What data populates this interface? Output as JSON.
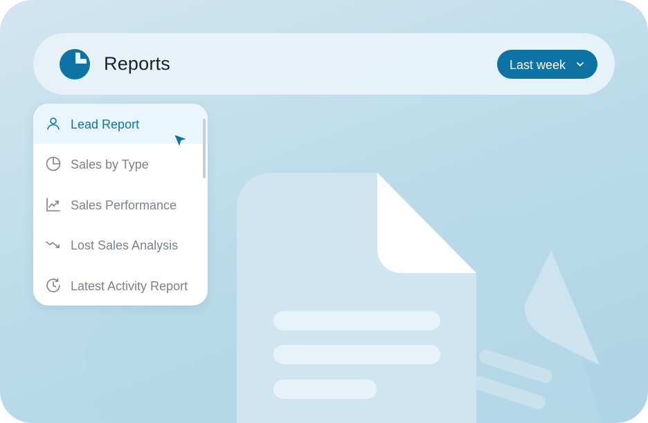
{
  "header": {
    "title": "Reports",
    "logo_icon": "pie-chart-icon",
    "period_button": {
      "label": "Last week",
      "icon": "chevron-down-icon"
    }
  },
  "menu": {
    "items": [
      {
        "label": "Lead Report",
        "icon": "user-icon",
        "active": true
      },
      {
        "label": "Sales by Type",
        "icon": "pie-chart-icon",
        "active": false
      },
      {
        "label": "Sales Performance",
        "icon": "trending-up-icon",
        "active": false
      },
      {
        "label": "Lost Sales Analysis",
        "icon": "trending-down-icon",
        "active": false
      },
      {
        "label": "Latest Activity Report",
        "icon": "clock-history-icon",
        "active": false
      }
    ]
  },
  "colors": {
    "accent": "#0d73a5",
    "background": "#bddcea",
    "title_text": "#172033",
    "menu_text": "#7b8188"
  }
}
